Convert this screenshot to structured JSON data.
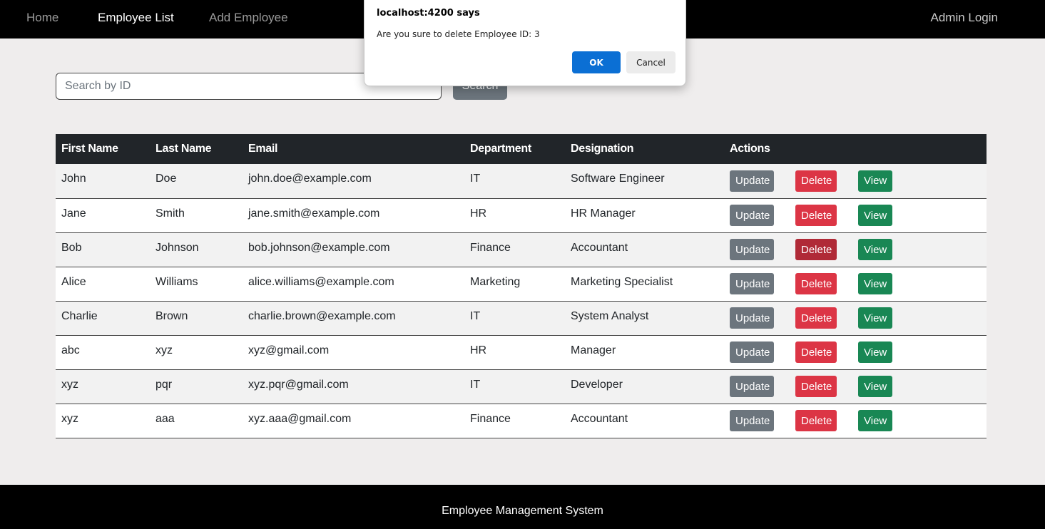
{
  "nav": {
    "home": "Home",
    "employee_list": "Employee List",
    "add_employee": "Add Employee",
    "admin_login": "Admin Login"
  },
  "search": {
    "placeholder": "Search by ID",
    "value": "",
    "button_label": "Search"
  },
  "table": {
    "headers": [
      "First Name",
      "Last Name",
      "Email",
      "Department",
      "Designation",
      "Actions"
    ],
    "rows": [
      [
        "John",
        "Doe",
        "john.doe@example.com",
        "IT",
        "Software Engineer"
      ],
      [
        "Jane",
        "Smith",
        "jane.smith@example.com",
        "HR",
        "HR Manager"
      ],
      [
        "Bob",
        "Johnson",
        "bob.johnson@example.com",
        "Finance",
        "Accountant"
      ],
      [
        "Alice",
        "Williams",
        "alice.williams@example.com",
        "Marketing",
        "Marketing Specialist"
      ],
      [
        "Charlie",
        "Brown",
        "charlie.brown@example.com",
        "IT",
        "System Analyst"
      ],
      [
        "abc",
        "xyz",
        "xyz@gmail.com",
        "HR",
        "Manager"
      ],
      [
        "xyz",
        "pqr",
        "xyz.pqr@gmail.com",
        "IT",
        "Developer"
      ],
      [
        "xyz",
        "aaa",
        "xyz.aaa@gmail.com",
        "Finance",
        "Accountant"
      ]
    ],
    "action_labels": {
      "update": "Update",
      "delete": "Delete",
      "view": "View"
    }
  },
  "footer": {
    "text": "Employee Management System"
  },
  "dialog": {
    "title": "localhost:4200 says",
    "message": "Are you sure to delete Employee ID: 3",
    "ok_label": "OK",
    "cancel_label": "Cancel"
  },
  "colors": {
    "navbar_bg": "#000000",
    "table_header_bg": "#212529",
    "update_button": "#6c757d",
    "delete_button": "#dc3545",
    "delete_button_pressed": "#b02a37",
    "view_button": "#198754",
    "dialog_ok": "#0b6fd4"
  }
}
